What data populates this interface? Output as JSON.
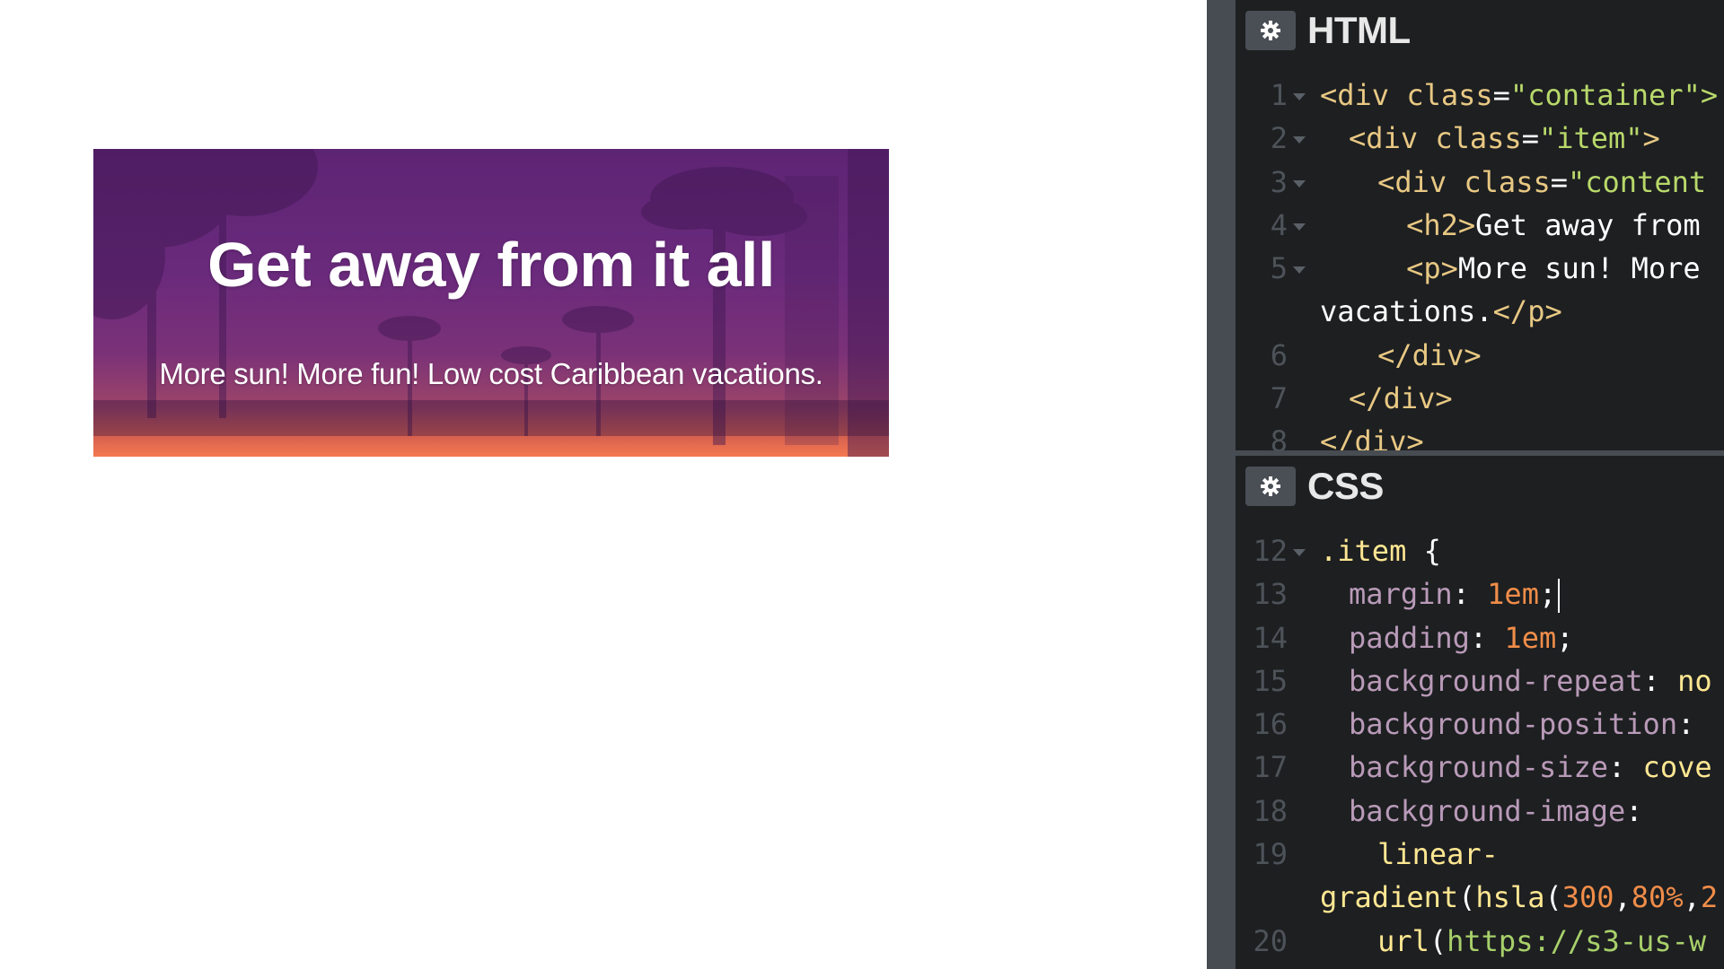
{
  "preview": {
    "heading": "Get away from it all",
    "subtext": "More sun! More fun! Low cost Caribbean vacations."
  },
  "html_panel": {
    "title": "HTML",
    "lines": [
      {
        "num": "1",
        "fold": true,
        "indent": 0,
        "tokens": [
          [
            "tag",
            "<div "
          ],
          [
            "attr",
            "class"
          ],
          [
            "punc",
            "="
          ],
          [
            "str",
            "\"container\">"
          ]
        ]
      },
      {
        "num": "2",
        "fold": true,
        "indent": 2,
        "tokens": [
          [
            "tag",
            "<div "
          ],
          [
            "attr",
            "class"
          ],
          [
            "punc",
            "="
          ],
          [
            "str",
            "\"item\""
          ],
          [
            "tag",
            ">"
          ]
        ]
      },
      {
        "num": "3",
        "fold": true,
        "indent": 4,
        "tokens": [
          [
            "tag",
            "<div "
          ],
          [
            "attr",
            "class"
          ],
          [
            "punc",
            "="
          ],
          [
            "str",
            "\"content"
          ]
        ]
      },
      {
        "num": "4",
        "fold": true,
        "indent": 6,
        "tokens": [
          [
            "tag",
            "<h2>"
          ],
          [
            "txtc",
            "Get away from"
          ]
        ]
      },
      {
        "num": "5",
        "fold": true,
        "indent": 6,
        "tokens": [
          [
            "tag",
            "<p>"
          ],
          [
            "txtc",
            "More sun! More"
          ]
        ]
      },
      {
        "num": "",
        "fold": false,
        "indent": 0,
        "tokens": [
          [
            "txtc",
            "vacations."
          ],
          [
            "tag",
            "</p>"
          ]
        ]
      },
      {
        "num": "6",
        "fold": false,
        "indent": 4,
        "tokens": [
          [
            "tag",
            "</div>"
          ]
        ]
      },
      {
        "num": "7",
        "fold": false,
        "indent": 2,
        "tokens": [
          [
            "tag",
            "</div>"
          ]
        ]
      },
      {
        "num": "8",
        "fold": false,
        "indent": 0,
        "tokens": [
          [
            "tag",
            "</div>"
          ]
        ]
      }
    ]
  },
  "css_panel": {
    "title": "CSS",
    "lines": [
      {
        "num": "12",
        "fold": true,
        "indent": 0,
        "tokens": [
          [
            "sel",
            ".item "
          ],
          [
            "punc",
            "{"
          ]
        ]
      },
      {
        "num": "13",
        "fold": false,
        "indent": 2,
        "tokens": [
          [
            "prop",
            "margin"
          ],
          [
            "punc",
            ": "
          ],
          [
            "num",
            "1em"
          ],
          [
            "punc",
            ";"
          ]
        ],
        "cursor": true
      },
      {
        "num": "14",
        "fold": false,
        "indent": 2,
        "tokens": [
          [
            "prop",
            "padding"
          ],
          [
            "punc",
            ": "
          ],
          [
            "num",
            "1em"
          ],
          [
            "punc",
            ";"
          ]
        ]
      },
      {
        "num": "15",
        "fold": false,
        "indent": 2,
        "tokens": [
          [
            "prop",
            "background-repeat"
          ],
          [
            "punc",
            ": "
          ],
          [
            "fn",
            "no"
          ]
        ]
      },
      {
        "num": "16",
        "fold": false,
        "indent": 2,
        "tokens": [
          [
            "prop",
            "background-position"
          ],
          [
            "punc",
            ":"
          ]
        ]
      },
      {
        "num": "17",
        "fold": false,
        "indent": 2,
        "tokens": [
          [
            "prop",
            "background-size"
          ],
          [
            "punc",
            ": "
          ],
          [
            "fn",
            "cove"
          ]
        ]
      },
      {
        "num": "18",
        "fold": false,
        "indent": 2,
        "tokens": [
          [
            "prop",
            "background-image"
          ],
          [
            "punc",
            ":"
          ]
        ]
      },
      {
        "num": "19",
        "fold": false,
        "indent": 4,
        "tokens": [
          [
            "fn",
            "linear-"
          ]
        ]
      },
      {
        "num": "",
        "fold": false,
        "indent": 0,
        "tokens": [
          [
            "fn",
            "gradient"
          ],
          [
            "punc",
            "("
          ],
          [
            "fn",
            "hsla"
          ],
          [
            "punc",
            "("
          ],
          [
            "num",
            "300"
          ],
          [
            "punc",
            ","
          ],
          [
            "num",
            "80%"
          ],
          [
            "punc",
            ","
          ],
          [
            "num",
            "2"
          ]
        ]
      },
      {
        "num": "20",
        "fold": false,
        "indent": 4,
        "tokens": [
          [
            "fn",
            "url"
          ],
          [
            "punc",
            "("
          ],
          [
            "url",
            "https://s3-us-w"
          ]
        ]
      }
    ]
  },
  "colors": {
    "editor_bg": "#1d1f21",
    "gutter_strip": "#474c52",
    "banner_top": "#5e2474",
    "banner_bottom": "#f57950"
  },
  "icons": [
    "gear-icon"
  ]
}
